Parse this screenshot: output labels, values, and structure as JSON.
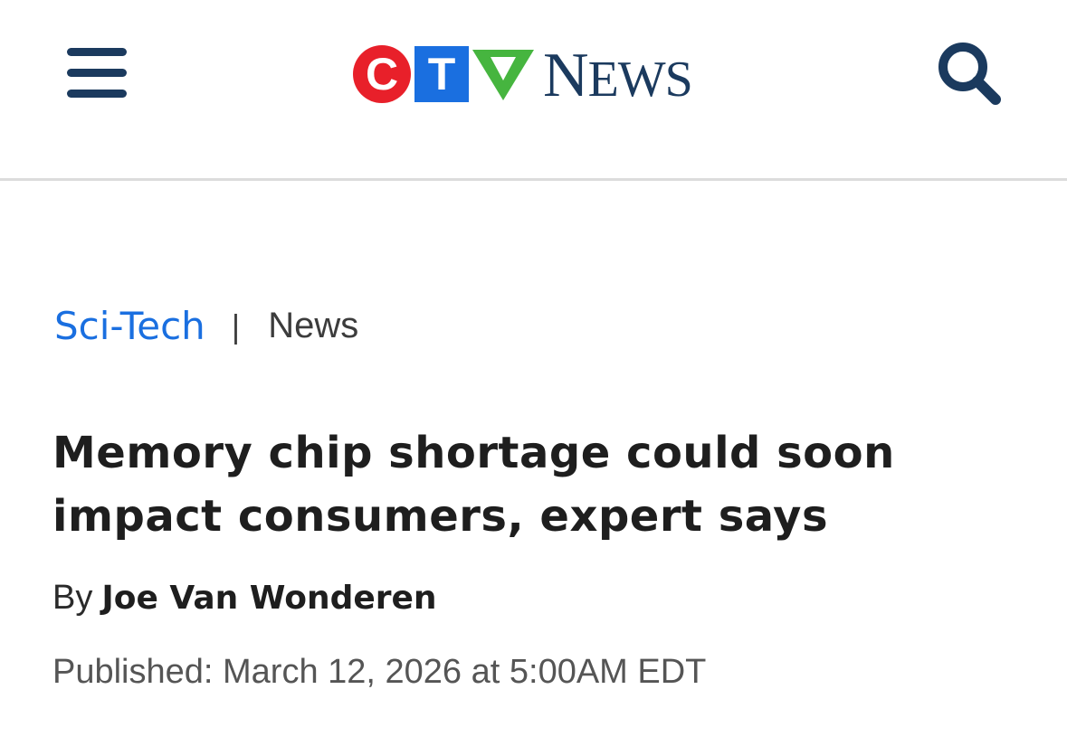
{
  "colors": {
    "brand_navy": "#1b3a5e",
    "link_blue": "#1a6fe0",
    "logo_red": "#e8202a",
    "logo_blue": "#1a6fe0",
    "logo_green": "#46b53f",
    "text_dark": "#1e1e1e",
    "text_muted": "#555555"
  },
  "header": {
    "menu_icon": "hamburger-menu-icon",
    "logo": {
      "mark_c": "C",
      "mark_t": "T",
      "word_first": "N",
      "word_rest": "EWS"
    },
    "search_icon": "search-icon"
  },
  "breadcrumb": {
    "section": "Sci-Tech",
    "separator": "|",
    "subsection": "News"
  },
  "article": {
    "headline": "Memory chip shortage could soon impact consumers, expert says",
    "byline_prefix": "By",
    "author": "Joe Van Wonderen",
    "published": "Published: March 12, 2026 at 5:00AM EDT"
  }
}
